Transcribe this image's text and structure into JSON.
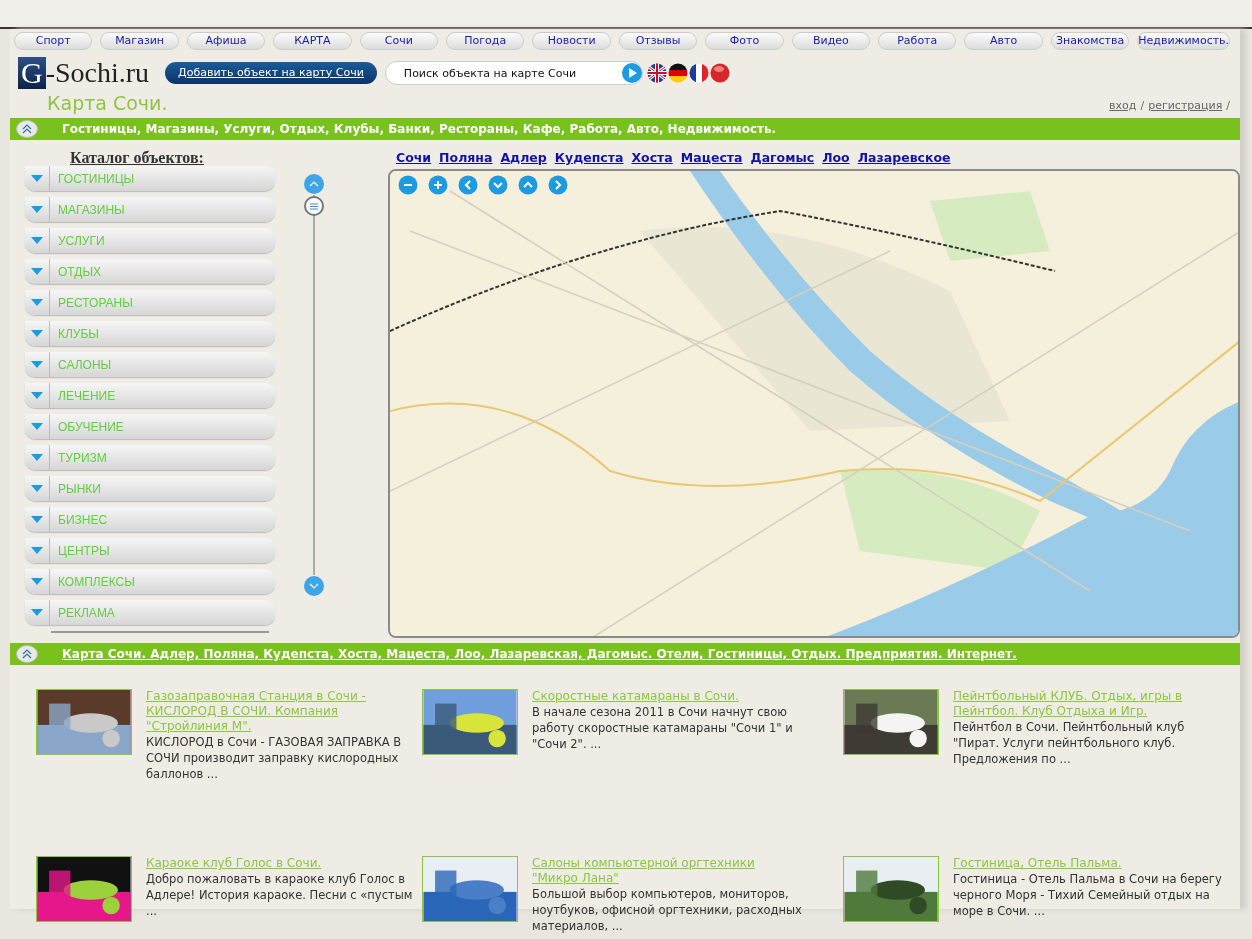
{
  "nav_tabs": [
    {
      "label": "Спорт"
    },
    {
      "label": "Магазин"
    },
    {
      "label": "Афиша"
    },
    {
      "label": "КАРТА"
    },
    {
      "label": "Сочи"
    },
    {
      "label": "Погода"
    },
    {
      "label": "Новости"
    },
    {
      "label": "Отзывы"
    },
    {
      "label": "Фото"
    },
    {
      "label": "Видео"
    },
    {
      "label": "Работа"
    },
    {
      "label": "Авто"
    },
    {
      "label": "Знакомства"
    },
    {
      "label": "Недвижимость."
    }
  ],
  "header": {
    "logo": {
      "mark": "G",
      "text": "-Sochi.ru"
    },
    "subtitle": "Карта Сочи.",
    "add_button": "Добавить объект на карту Сочи",
    "search": {
      "value": "Поиск объекта на карте Сочи"
    },
    "languages": [
      {
        "kind": "uk"
      },
      {
        "kind": "de"
      },
      {
        "kind": "fr"
      },
      {
        "kind": "red"
      }
    ],
    "account_links": [
      {
        "label": "вход",
        "separator": "/"
      },
      {
        "label": "регистрация",
        "separator": "/"
      }
    ]
  },
  "top_banner": "Гостиницы, Магазины, Услуги, Отдых, Клубы, Банки, Рестораны, Кафе, Работа, Авто, Недвижимость.",
  "catalog": {
    "title": "Каталог объектов:",
    "items": [
      {
        "label": "ГОСТИНИЦЫ"
      },
      {
        "label": "МАГАЗИНЫ"
      },
      {
        "label": "УСЛУГИ"
      },
      {
        "label": "ОТДЫХ"
      },
      {
        "label": "РЕСТОРАНЫ"
      },
      {
        "label": "КЛУБЫ"
      },
      {
        "label": "САЛОНЫ"
      },
      {
        "label": "ЛЕЧЕНИЕ"
      },
      {
        "label": "ОБУЧЕНИЕ"
      },
      {
        "label": "ТУРИЗМ"
      },
      {
        "label": "РЫНКИ"
      },
      {
        "label": "БИЗНЕС"
      },
      {
        "label": "ЦЕНТРЫ"
      },
      {
        "label": "КОМПЛЕКСЫ"
      },
      {
        "label": "РЕКЛАМА"
      }
    ]
  },
  "map": {
    "city_links": [
      "Сочи",
      "Поляна",
      "Адлер",
      "Кудепста",
      "Хоста",
      "Мацеста",
      "Дагомыс",
      "Лоо",
      "Лазаревское"
    ],
    "controls": [
      {
        "kind": "zoom-out"
      },
      {
        "kind": "zoom-in"
      },
      {
        "kind": "left"
      },
      {
        "kind": "down"
      },
      {
        "kind": "up"
      },
      {
        "kind": "right"
      }
    ]
  },
  "bottom_banner": "Карта Сочи. Адлер, Поляна, Кудепста, Хоста, Мацеста, Лоо, Лазаревская, Дагомыс. Отели, Гостиницы, Отдых. Предприятия. Интернет.",
  "listings": [
    {
      "title": "Газозаправочная Станция в Сочи - КИСЛОРОД В СОЧИ. Компания \"Стройлиния М\".",
      "text": "КИСЛОРОД в Сочи - ГАЗОВАЯ ЗАПРАВКА В СОЧИ производит заправку кислородных баллонов ...",
      "kind": "picture"
    },
    {
      "title": "Скоростные катамараны в Сочи.",
      "text": "В начале сезона 2011 в Сочи начнут свою работу скоростные катамараны \"Сочи 1\" и \"Сочи 2\".  ...",
      "kind": "picture"
    },
    {
      "title": "Пейнтбольный КЛУБ. Отдых, игры в Пейнтбол. Клуб Отдыха и Игр.",
      "text": "Пейнтбол в Сочи. Пейнтбольный клуб \"Пират. Услуги пейнтбольного клуб. Предложения по ...",
      "kind": "picture"
    },
    {
      "title": "Караоке клуб Голос в Сочи.",
      "text": "Добро пожаловать в караоке клуб Голос в Адлере! История караоке. Песни с «пустым ...",
      "kind": "picture"
    },
    {
      "title": "Салоны компьютерной оргтехники \"Микро Лана\"",
      "text": "Большой выбор компьютеров, мониторов, ноутбуков, офисной оргтехники, расходных материалов, ...",
      "kind": "picture"
    },
    {
      "title": "Гостиница, Отель Пальма.",
      "text": "Гостиница - Отель Пальма в Сочи на берегу черного Моря - Тихий Семейный отдых на море в Сочи. ...",
      "kind": "picture"
    }
  ]
}
